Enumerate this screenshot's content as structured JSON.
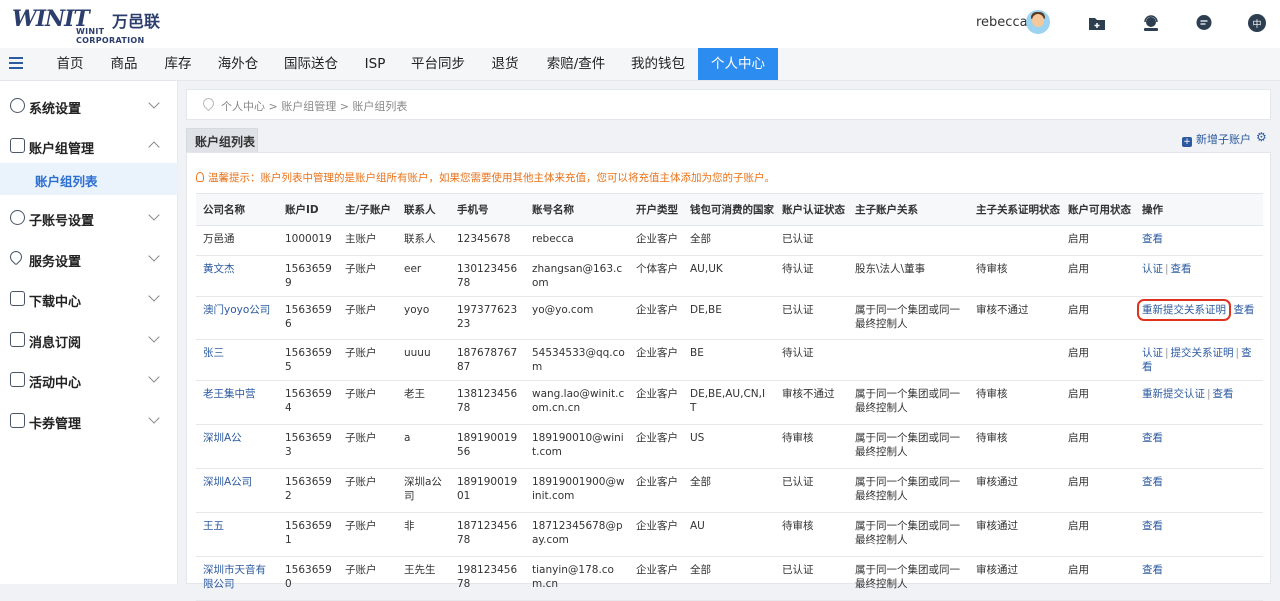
{
  "brand": {
    "mark": "WINIT",
    "cn": "万邑联",
    "en": "WINIT CORPORATION"
  },
  "user": {
    "name": "rebecca"
  },
  "top_icons": {
    "lang": "中"
  },
  "nav": [
    "首页",
    "商品",
    "库存",
    "海外仓",
    "国际送仓",
    "ISP",
    "平台同步",
    "退货",
    "索赔/查件",
    "我的钱包",
    "个人中心"
  ],
  "sidebar": {
    "items": [
      "系统设置",
      "账户组管理",
      "子账号设置",
      "服务设置",
      "下载中心",
      "消息订阅",
      "活动中心",
      "卡券管理"
    ],
    "sub": "账户组列表"
  },
  "breadcrumb": "个人中心 > 账户组管理 > 账户组列表",
  "panel": {
    "tab": "账户组列表",
    "add_label": "新增子账户"
  },
  "tip": "温馨提示：账户列表中管理的是账户组所有账户，如果您需要使用其他主体来充值，您可以将充值主体添加为您的子账户。",
  "table": {
    "headers": [
      "公司名称",
      "账户ID",
      "主/子账户",
      "联系人",
      "手机号",
      "账号名称",
      "开户类型",
      "钱包可消费的国家",
      "账户认证状态",
      "主子账户关系",
      "主子关系证明状态",
      "账户可用状态",
      "操作"
    ],
    "rows": [
      {
        "company": "万邑通",
        "id": "1000019",
        "type": "主账户",
        "contact": "联系人",
        "phone": "12345678",
        "account": "rebecca",
        "open": "企业客户",
        "countries": "全部",
        "auth": "已认证",
        "relation": "",
        "proof": "",
        "status": "启用",
        "ops": [
          "查看"
        ]
      },
      {
        "company": "黄文杰",
        "id": "15636599",
        "type": "子账户",
        "contact": "eer",
        "phone": "13012345678",
        "account": "zhangsan@163.com",
        "open": "个体客户",
        "countries": "AU,UK",
        "auth": "待认证",
        "relation": "股东\\法人\\董事",
        "proof": "待审核",
        "status": "启用",
        "ops": [
          "认证",
          "查看"
        ]
      },
      {
        "company": "澳门yoyo公司",
        "id": "15636596",
        "type": "子账户",
        "contact": "yoyo",
        "phone": "19737762323",
        "account": "yo@yo.com",
        "open": "企业客户",
        "countries": "DE,BE",
        "auth": "已认证",
        "relation": "属于同一个集团或同一最终控制人",
        "proof": "审核不通过",
        "status": "启用",
        "ops": [
          "重新提交关系证明",
          "查看"
        ]
      },
      {
        "company": "张三",
        "id": "15636595",
        "type": "子账户",
        "contact": "uuuu",
        "phone": "18767876787",
        "account": "54534533@qq.com",
        "open": "企业客户",
        "countries": "BE",
        "auth": "待认证",
        "relation": "",
        "proof": "",
        "status": "启用",
        "ops": [
          "认证",
          "提交关系证明",
          "查看"
        ]
      },
      {
        "company": "老王集中营",
        "id": "15636594",
        "type": "子账户",
        "contact": "老王",
        "phone": "13812345678",
        "account": "wang.lao@winit.com.cn.cn",
        "open": "企业客户",
        "countries": "DE,BE,AU,CN,IT",
        "auth": "审核不通过",
        "relation": "属于同一个集团或同一最终控制人",
        "proof": "待审核",
        "status": "启用",
        "ops": [
          "重新提交认证",
          "查看"
        ]
      },
      {
        "company": "深圳A公",
        "id": "15636593",
        "type": "子账户",
        "contact": "a",
        "phone": "18919001956",
        "account": "189190010@winit.com",
        "open": "企业客户",
        "countries": "US",
        "auth": "待审核",
        "relation": "属于同一个集团或同一最终控制人",
        "proof": "待审核",
        "status": "启用",
        "ops": [
          "查看"
        ]
      },
      {
        "company": "深圳A公司",
        "id": "15636592",
        "type": "子账户",
        "contact": "深圳a公司",
        "phone": "18919001901",
        "account": "18919001900@winit.com",
        "open": "企业客户",
        "countries": "全部",
        "auth": "已认证",
        "relation": "属于同一个集团或同一最终控制人",
        "proof": "审核通过",
        "status": "启用",
        "ops": [
          "查看"
        ]
      },
      {
        "company": "王五",
        "id": "15636591",
        "type": "子账户",
        "contact": "非",
        "phone": "18712345678",
        "account": "18712345678@pay.com",
        "open": "企业客户",
        "countries": "AU",
        "auth": "待审核",
        "relation": "属于同一个集团或同一最终控制人",
        "proof": "审核通过",
        "status": "启用",
        "ops": [
          "查看"
        ]
      },
      {
        "company": "深圳市天音有限公司",
        "id": "15636590",
        "type": "子账户",
        "contact": "王先生",
        "phone": "19812345678",
        "account": "tianyin@178.com.cn",
        "open": "企业客户",
        "countries": "全部",
        "auth": "已认证",
        "relation": "属于同一个集团或同一最终控制人",
        "proof": "审核通过",
        "status": "启用",
        "ops": [
          "查看"
        ]
      }
    ]
  }
}
